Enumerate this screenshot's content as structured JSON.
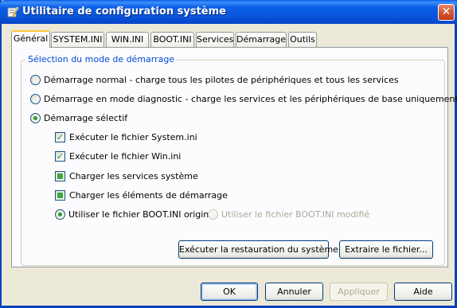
{
  "window": {
    "title": "Utilitaire de configuration système",
    "close_symbol": "✕"
  },
  "tabs": [
    {
      "label": "Général",
      "active": true
    },
    {
      "label": "SYSTEM.INI",
      "active": false
    },
    {
      "label": "WIN.INI",
      "active": false
    },
    {
      "label": "BOOT.INI",
      "active": false
    },
    {
      "label": "Services",
      "active": false
    },
    {
      "label": "Démarrage",
      "active": false
    },
    {
      "label": "Outils",
      "active": false
    }
  ],
  "startup_group": {
    "legend": "Sélection du mode de démarrage",
    "options": [
      {
        "label": "Démarrage normal - charge tous les pilotes de périphériques et tous les services",
        "selected": false
      },
      {
        "label": "Démarrage en mode diagnostic - charge les services et les périphériques de base uniquement",
        "selected": false
      },
      {
        "label": "Démarrage sélectif",
        "selected": true
      }
    ],
    "checks": [
      {
        "label": "Exécuter le fichier System.ini",
        "state": "checked"
      },
      {
        "label": "Exécuter le fichier Win.ini",
        "state": "checked"
      },
      {
        "label": "Charger les services système",
        "state": "mixed"
      },
      {
        "label": "Charger les éléments de démarrage",
        "state": "mixed"
      }
    ],
    "boot_options": [
      {
        "label": "Utiliser le fichier BOOT.INI original",
        "selected": true,
        "enabled": true
      },
      {
        "label": "Utiliser le fichier BOOT.INI modifié",
        "selected": false,
        "enabled": false
      }
    ],
    "restore_button": "Exécuter la restauration du système",
    "extract_button": "Extraire le fichier..."
  },
  "footer": {
    "ok": "OK",
    "cancel": "Annuler",
    "apply": "Appliquer",
    "help": "Aide"
  },
  "icons": {
    "title": "msconfig-icon",
    "close": "close-icon"
  },
  "colors": {
    "titlebar": "#0a54db",
    "legend_text": "#0046d5",
    "check_mark": "#21a121",
    "window_bg": "#ece9d8"
  }
}
